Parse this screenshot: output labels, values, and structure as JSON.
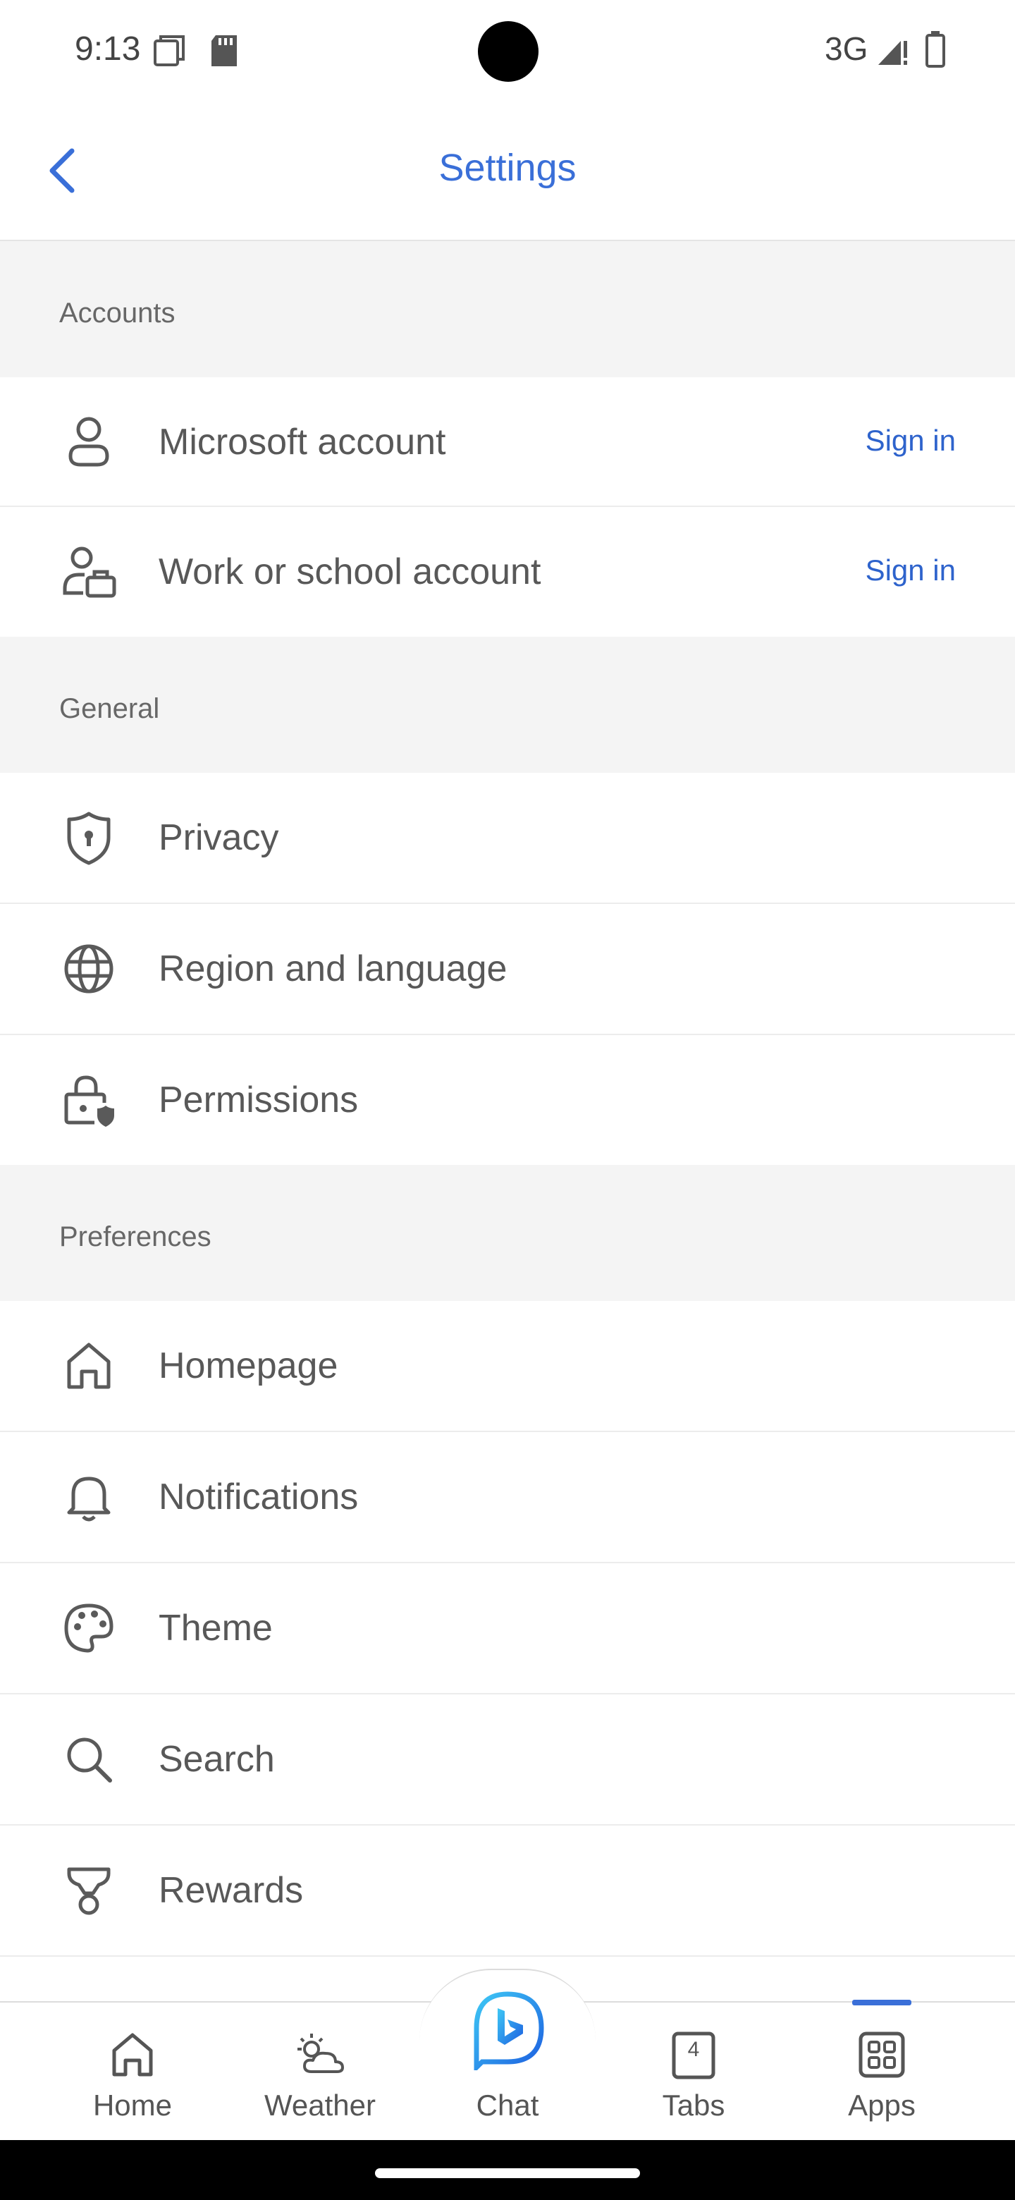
{
  "status_bar": {
    "time": "9:13",
    "network": "3G"
  },
  "header": {
    "title": "Settings"
  },
  "sections": {
    "accounts": {
      "title": "Accounts",
      "items": [
        {
          "label": "Microsoft account",
          "action": "Sign in",
          "icon": "person-icon"
        },
        {
          "label": "Work or school account",
          "action": "Sign in",
          "icon": "work-account-icon"
        }
      ]
    },
    "general": {
      "title": "General",
      "items": [
        {
          "label": "Privacy",
          "icon": "shield-icon"
        },
        {
          "label": "Region and language",
          "icon": "globe-icon"
        },
        {
          "label": "Permissions",
          "icon": "lock-shield-icon"
        }
      ]
    },
    "preferences": {
      "title": "Preferences",
      "items": [
        {
          "label": "Homepage",
          "icon": "home-icon"
        },
        {
          "label": "Notifications",
          "icon": "bell-icon"
        },
        {
          "label": "Theme",
          "icon": "palette-icon"
        },
        {
          "label": "Search",
          "icon": "search-icon"
        },
        {
          "label": "Rewards",
          "icon": "trophy-icon"
        }
      ]
    }
  },
  "bottom_nav": {
    "items": [
      {
        "label": "Home",
        "icon": "home-icon"
      },
      {
        "label": "Weather",
        "icon": "weather-icon"
      },
      {
        "label": "Chat",
        "icon": "bing-chat-icon"
      },
      {
        "label": "Tabs",
        "icon": "tabs-icon",
        "count": "4"
      },
      {
        "label": "Apps",
        "icon": "apps-grid-icon"
      }
    ],
    "active": "Apps"
  },
  "colors": {
    "accent": "#3a6fd8",
    "link": "#2e63cc",
    "section_bg": "#f4f4f4",
    "text": "#585858"
  }
}
